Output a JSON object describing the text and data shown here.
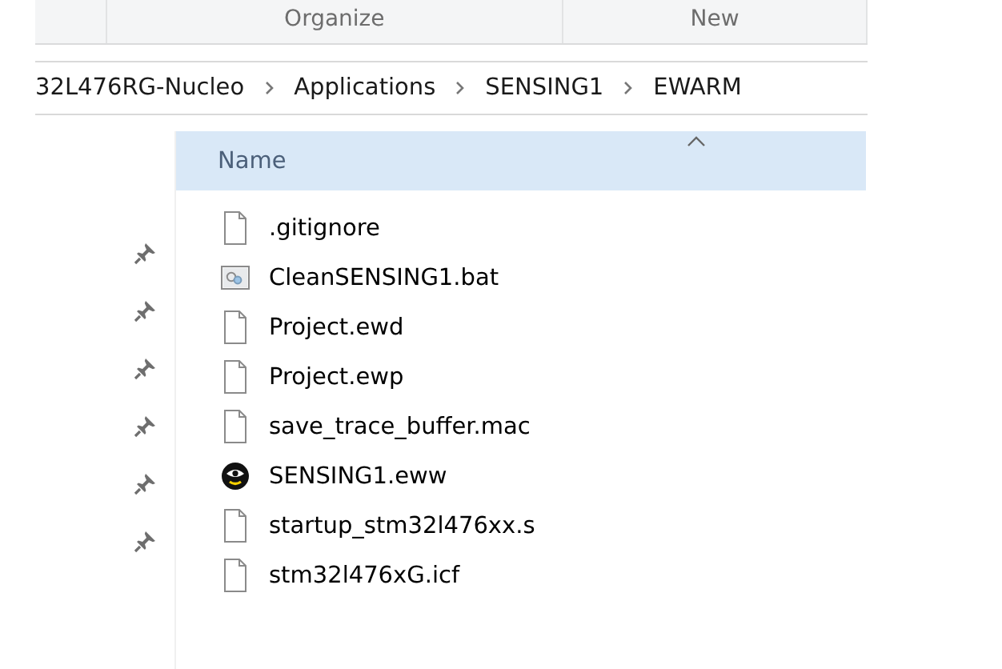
{
  "ribbon": {
    "groups": [
      "Organize",
      "New"
    ]
  },
  "address_bar": {
    "crumbs": [
      "32L476RG-Nucleo",
      "Applications",
      "SENSING1",
      "EWARM"
    ]
  },
  "quick_access": {
    "items": [
      {
        "pinned": true
      },
      {
        "pinned": true
      },
      {
        "pinned": true
      },
      {
        "pinned": true
      },
      {
        "pinned": true
      },
      {
        "pinned": true
      }
    ]
  },
  "file_list": {
    "columns": [
      {
        "label": "Name",
        "sorted": true
      }
    ],
    "files": [
      {
        "name": ".gitignore",
        "kind": "blank"
      },
      {
        "name": "CleanSENSING1.bat",
        "kind": "batch"
      },
      {
        "name": "Project.ewd",
        "kind": "blank"
      },
      {
        "name": "Project.ewp",
        "kind": "blank"
      },
      {
        "name": "save_trace_buffer.mac",
        "kind": "blank"
      },
      {
        "name": "SENSING1.eww",
        "kind": "workspace"
      },
      {
        "name": "startup_stm32l476xx.s",
        "kind": "blank"
      },
      {
        "name": "stm32l476xG.icf",
        "kind": "blank"
      }
    ]
  }
}
